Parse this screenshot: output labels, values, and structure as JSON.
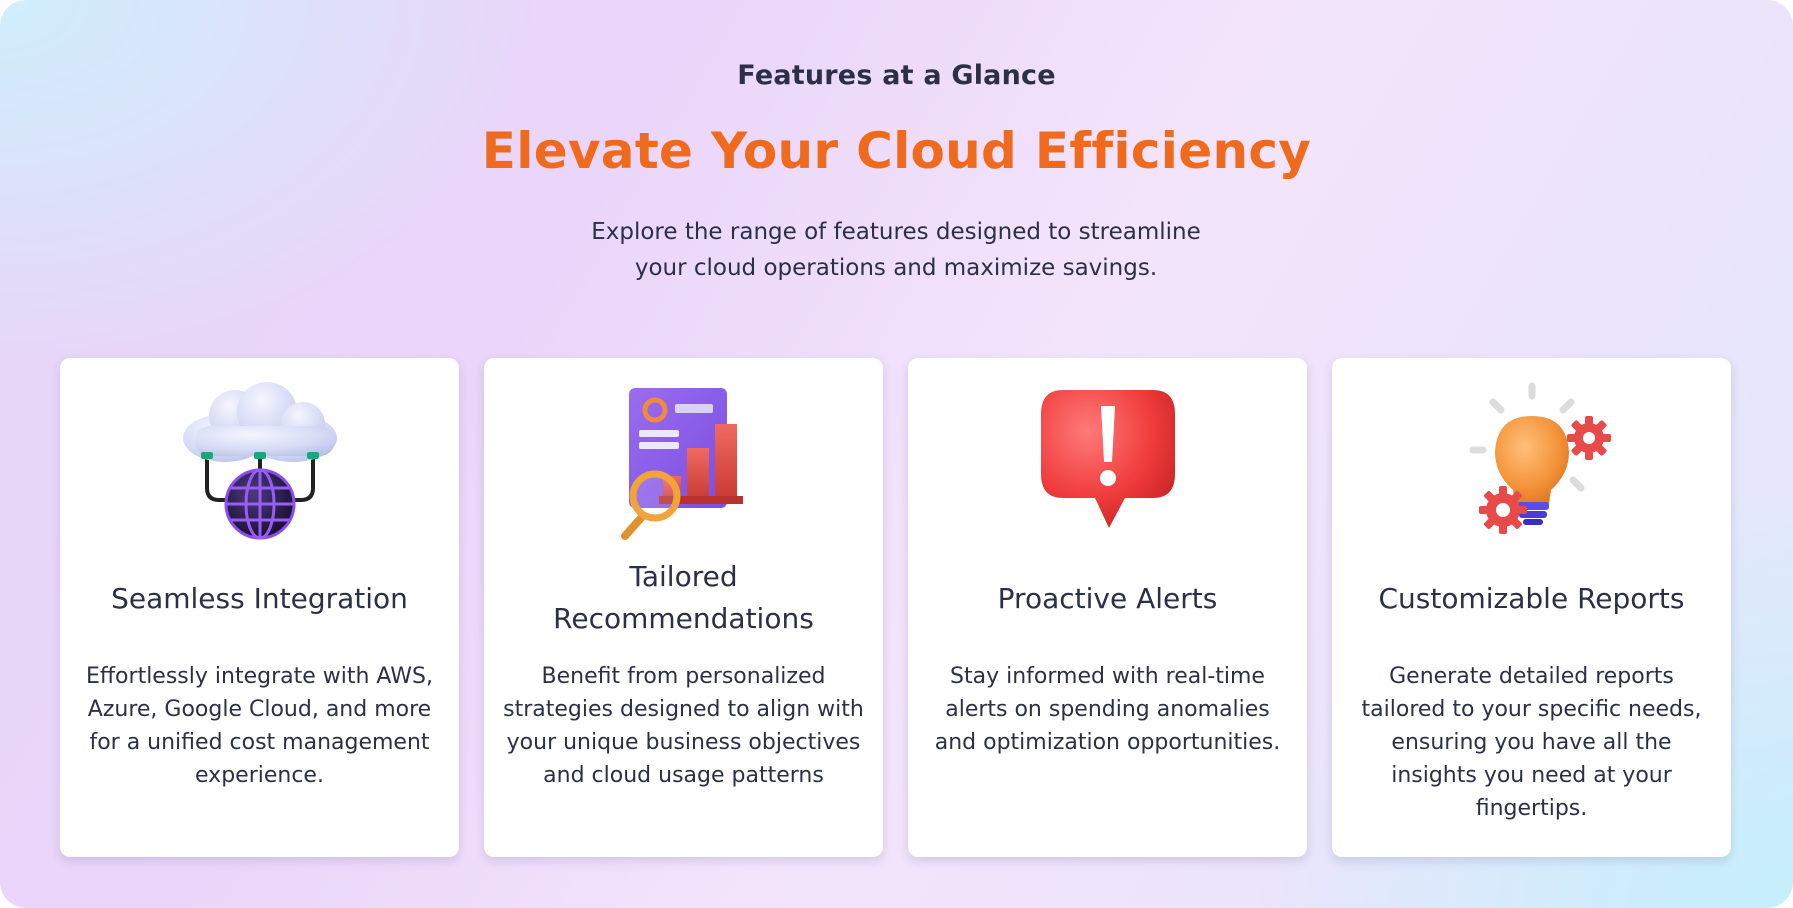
{
  "section": {
    "eyebrow": "Features at a Glance",
    "headline": "Elevate Your Cloud Efficiency",
    "subtext_line1": "Explore the range of features designed to streamline",
    "subtext_line2": "your cloud operations and maximize savings."
  },
  "colors": {
    "headline": "#f06a1e",
    "text": "#2b3046",
    "card_bg": "#ffffff"
  },
  "cards": [
    {
      "icon": "cloud-globe-icon",
      "title": "Seamless Integration",
      "description": "Effortlessly integrate with AWS, Azure, Google Cloud, and more for a unified cost management experience."
    },
    {
      "icon": "report-chart-magnifier-icon",
      "title": "Tailored Recommendations",
      "description": "Benefit from personalized strategies designed to align with your unique business objectives and cloud usage patterns"
    },
    {
      "icon": "alert-speech-bubble-icon",
      "title": "Proactive Alerts",
      "description": "Stay informed with real-time alerts on spending anomalies and optimization opportunities."
    },
    {
      "icon": "lightbulb-gears-icon",
      "title": "Customizable Reports",
      "description": "Generate detailed reports tailored to your specific needs, ensuring you have all the insights you need at your fingertips."
    }
  ]
}
